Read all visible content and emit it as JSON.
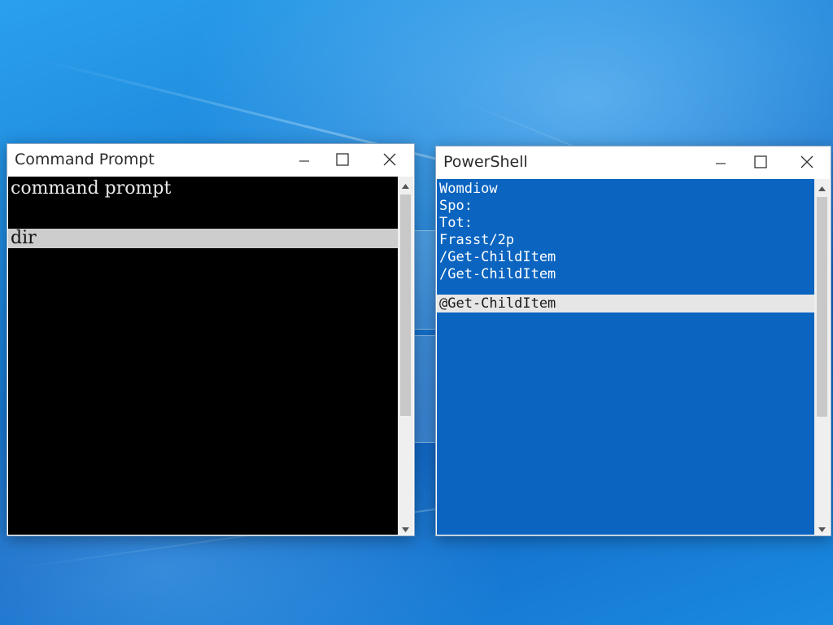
{
  "desktop": {
    "accent": "#1a7fd6"
  },
  "cmd_window": {
    "title": "Command Prompt",
    "controls": {
      "minimize_icon": "minimize-icon",
      "maximize_icon": "maximize-icon",
      "close_icon": "close-icon"
    },
    "lines": [
      "command prompt",
      "",
      "dir"
    ],
    "selected_line_index": 2,
    "background_color": "#000000",
    "text_color": "#e8e8e8"
  },
  "ps_window": {
    "title": "PowerShell",
    "controls": {
      "minimize_icon": "minimize-icon",
      "maximize_icon": "maximize-icon",
      "close_icon": "close-icon"
    },
    "lines": [
      "Womdiow",
      "Spo:",
      "Tot:",
      "Frasst/2p",
      "/Get-ChildItem",
      "/Get-ChildItem",
      "@Get-ChildItem"
    ],
    "selected_line_index": 6,
    "background_color": "#0a64c0",
    "text_color": "#ffffff"
  }
}
